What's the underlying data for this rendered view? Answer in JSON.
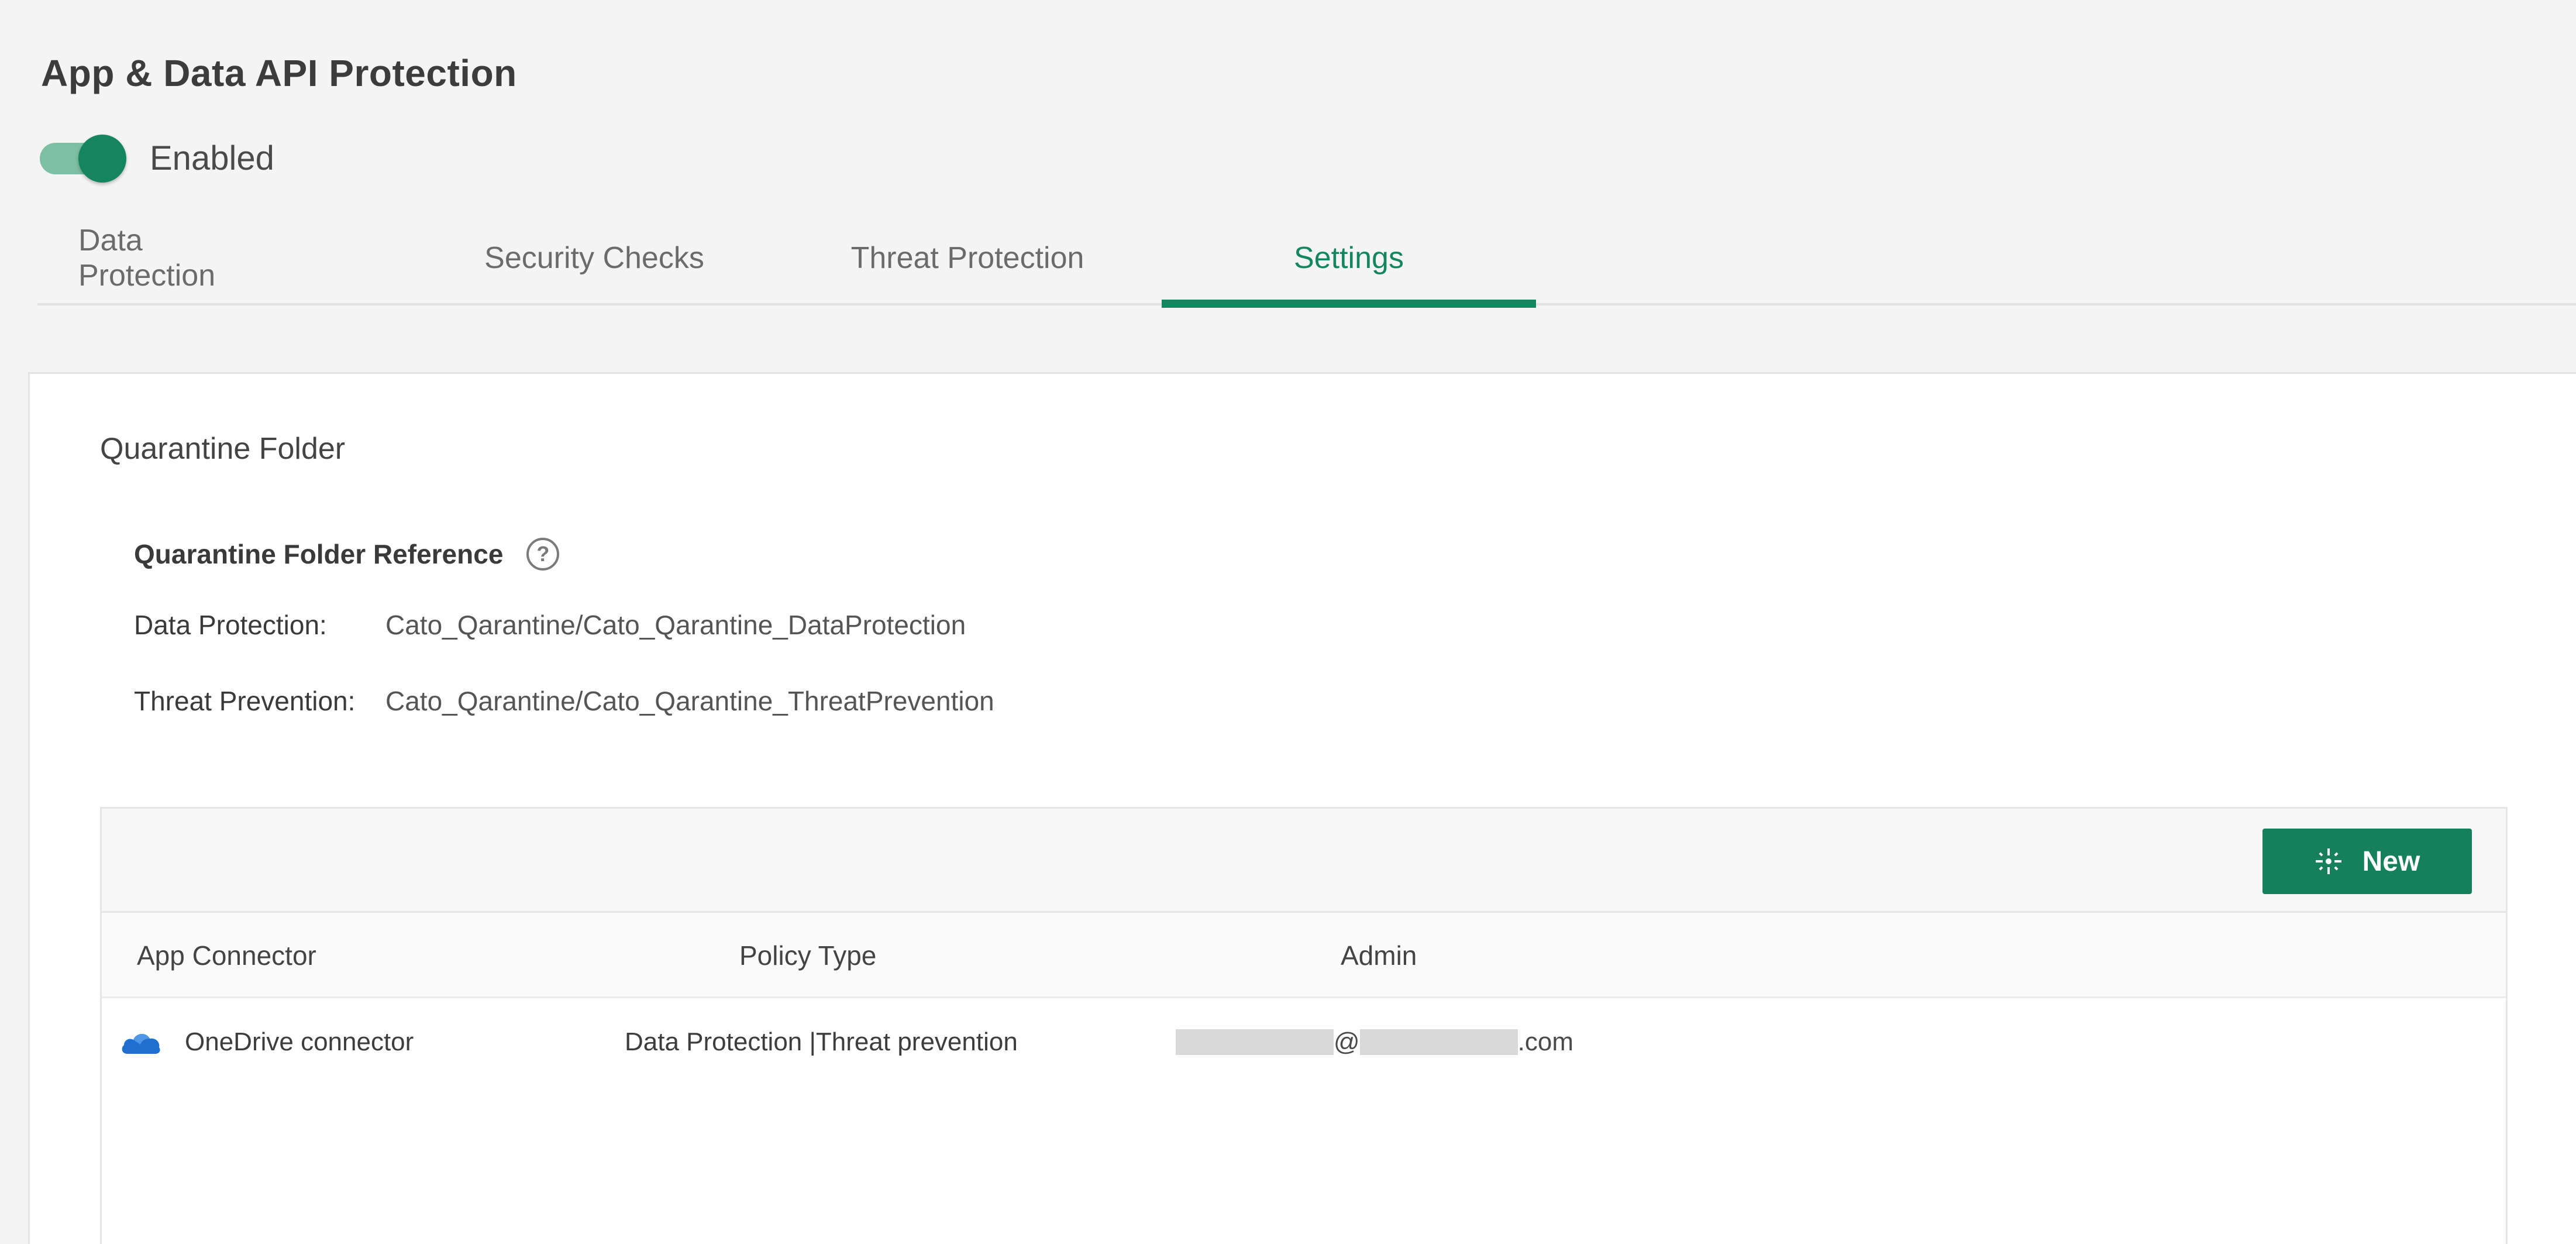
{
  "header": {
    "title": "App & Data API Protection"
  },
  "toggle": {
    "state": "on",
    "label": "Enabled"
  },
  "tabs": [
    {
      "label": "Data Protection",
      "active": false
    },
    {
      "label": "Security Checks",
      "active": false
    },
    {
      "label": "Threat Protection",
      "active": false
    },
    {
      "label": "Settings",
      "active": true
    }
  ],
  "quarantine": {
    "section_title": "Quarantine Folder",
    "reference_title": "Quarantine Folder Reference",
    "help_icon": "question-circle-icon",
    "rows": [
      {
        "label": "Data Protection:",
        "value": "Cato_Qarantine/Cato_Qarantine_DataProtection"
      },
      {
        "label": "Threat Prevention:",
        "value": "Cato_Qarantine/Cato_Qarantine_ThreatPrevention"
      }
    ]
  },
  "table": {
    "new_button_label": "New",
    "new_button_icon": "sparkle-icon",
    "columns": [
      "App Connector",
      "Policy Type",
      "Admin"
    ],
    "rows": [
      {
        "icon": "onedrive-cloud-icon",
        "connector": "OneDrive connector",
        "policy_type": "Data Protection |Threat prevention",
        "admin_at": "@",
        "admin_suffix": ".com"
      }
    ]
  },
  "colors": {
    "accent": "#15855f",
    "toggle_track": "#7dbfa4",
    "button": "#16805c",
    "onedrive": "#1f6fd1"
  }
}
